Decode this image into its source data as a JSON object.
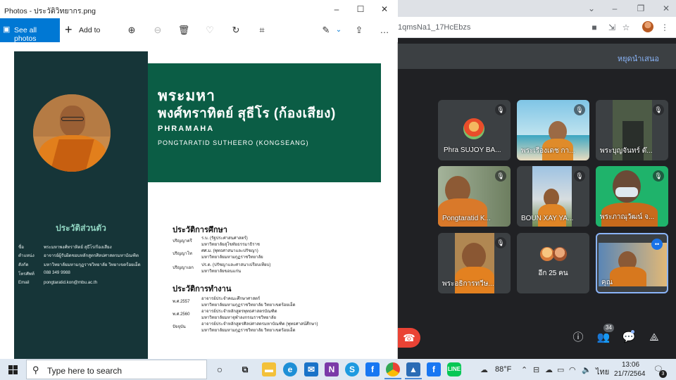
{
  "photos": {
    "title": "Photos - ประวัติวิทยากร.png",
    "see_all": "See all photos",
    "add_to": "Add to"
  },
  "chrome": {
    "url_fragment": "1qmsNa1_17HcEbzs"
  },
  "meet": {
    "stop_presenting": "หยุดนำเสนอ",
    "tiles": [
      {
        "name": "Phra SUJOY BA..."
      },
      {
        "name": "พระเรืองเดช กา..."
      },
      {
        "name": "พระบุญจันทร์ ต๊..."
      },
      {
        "name": "Pongtaratid K..."
      },
      {
        "name": "BOUN XAY YA..."
      },
      {
        "name": "พระภาณุวัฒน์ จ..."
      },
      {
        "name": "พระอธิการทวีษ..."
      },
      {
        "name": "อีก 25 คน"
      },
      {
        "name": "คุณ"
      }
    ],
    "participant_count": "34"
  },
  "cv": {
    "name_line1": "พระมหา",
    "name_line2": "พงศ์ทราทิตย์ สุธีโร (ก้องเสียง)",
    "name_line3": "PHRAMAHA",
    "name_line4": "PONGTARATID SUTHEERO (KONGSEANG)",
    "side_title": "ประวัติส่วนตัว",
    "info": [
      {
        "label": "ชื่อ",
        "value": "พระมหาพงศ์ทราทิตย์ สุธีโร/ก้องเสียง"
      },
      {
        "label": "ตำแหน่ง",
        "value": "อาจารย์ผู้รับผิดชอบหลักสูตรศิลปศาสตรมหาบัณฑิต"
      },
      {
        "label": "สังกัด",
        "value": "มหาวิทยาลัยมหามกุฏราชวิทยาลัย วิทยาเขตร้อยเอ็ด"
      },
      {
        "label": "โทรศัพท์",
        "value": "088 349 9988"
      },
      {
        "label": "Email",
        "value": "pongtaratid.kon@mbu.ac.th"
      }
    ],
    "education_title": "ประวัติการศึกษา",
    "education": [
      {
        "label": "ปริญญาตรี",
        "line1": "ร.บ. (รัฐประศาสนศาสตร์)",
        "line2": "มหาวิทยาลัยสุโขทัยธรรมาธิราช"
      },
      {
        "label": "ปริญญาโท",
        "line1": "ศศ.ม. (พุทธศาสนาและปรัชญา)",
        "line2": "มหาวิทยาลัยมหามกุฏราชวิทยาลัย"
      },
      {
        "label": "ปริญญาเอก",
        "line1": "ปร.ด. (ปรัชญาและศาสนาเปรียบเทียบ)",
        "line2": "มหาวิทยาลัยขอนแก่น"
      }
    ],
    "work_title": "ประวัติการทำงาน",
    "work": [
      {
        "label": "พ.ศ.2557",
        "line1": "อาจารย์ประจำคณะศึกษาศาสตร์",
        "line2": "มหาวิทยาลัยมหามกุฏราชวิทยาลัย วิทยาเขตร้อยเอ็ด"
      },
      {
        "label": "พ.ศ.2560",
        "line1": "อาจารย์ประจำหลักสูตรพุทธศาสตรบัณฑิต",
        "line2": "มหาวิทยาลัยมหาจุฬาลงกรณราชวิทยาลัย"
      },
      {
        "label": "ปัจจุบัน",
        "line1": "อาจารย์ประจำหลักสูตรศิลปศาสตรมหาบัณฑิต (พุทธศาสน์ศึกษา)",
        "line2": "มหาวิทยาลัยมหามกุฏราชวิทยาลัย วิทยาเขตร้อยเอ็ด"
      }
    ]
  },
  "taskbar": {
    "search_placeholder": "Type here to search",
    "temperature": "88°F",
    "language": "ไทย",
    "time": "13:06",
    "date": "21/7/2564",
    "notification_count": "3"
  },
  "colors": {
    "cv_sidebar": "#163538",
    "cv_banner": "#0b5d45",
    "photos_accent": "#0078d4",
    "meet_bg": "#202124",
    "hangup": "#ea4335"
  }
}
